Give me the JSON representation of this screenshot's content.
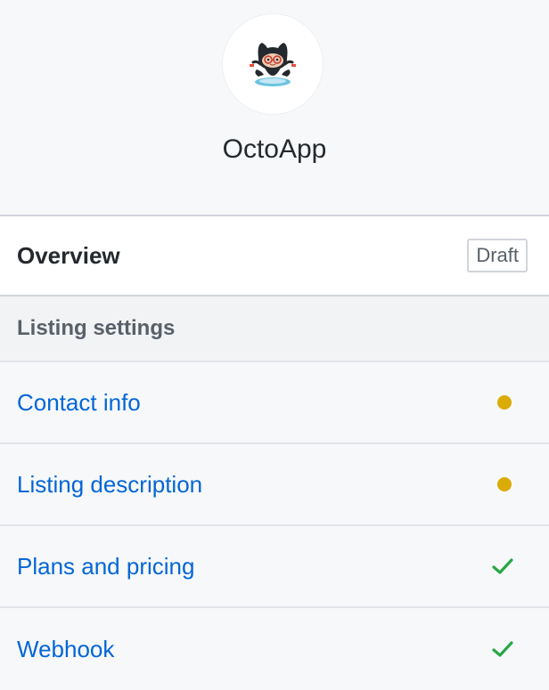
{
  "app": {
    "name": "OctoApp",
    "avatar_icon": "octocat-logo-icon"
  },
  "overview": {
    "label": "Overview",
    "badge": "Draft"
  },
  "listing_settings": {
    "heading": "Listing settings",
    "items": [
      {
        "label": "Contact info",
        "status": "incomplete"
      },
      {
        "label": "Listing description",
        "status": "incomplete"
      },
      {
        "label": "Plans and pricing",
        "status": "complete"
      },
      {
        "label": "Webhook",
        "status": "complete"
      }
    ]
  },
  "colors": {
    "link": "#0366d6",
    "incomplete": "#dbab09",
    "complete": "#28a745",
    "border": "#d1d5da",
    "background": "#f6f8fa"
  }
}
